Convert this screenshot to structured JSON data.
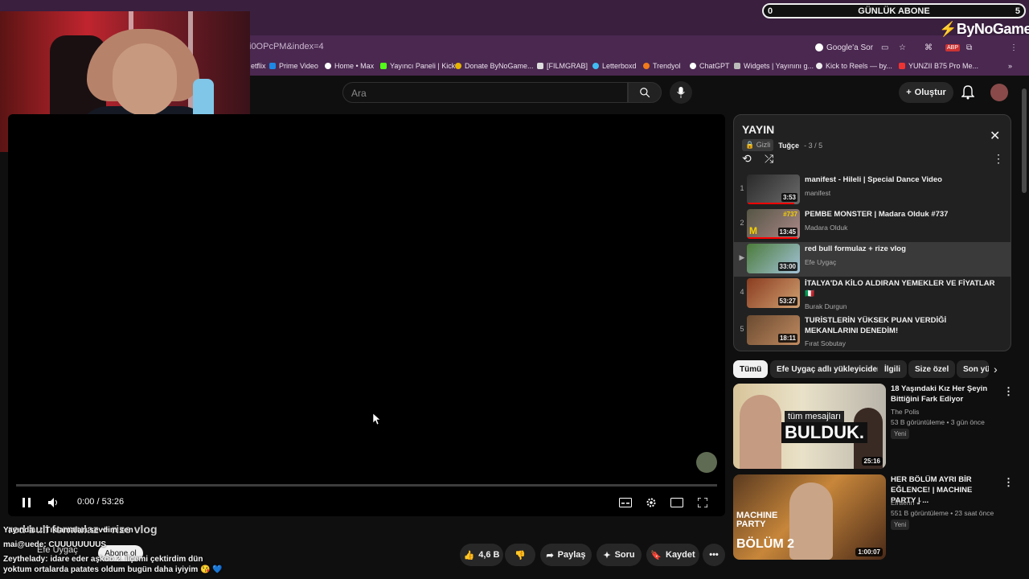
{
  "browser": {
    "url_fragment": "i0OPcPM&index=4",
    "google_chip": "Google'a Sor",
    "bookmarks": [
      "etflix",
      "Prime Video",
      "Home • Max",
      "Yayıncı Paneli | Kick",
      "Donate ByNoGame...",
      "[FILMGRAB]",
      "Letterboxd",
      "Trendyol",
      "ChatGPT",
      "Widgets | Yayınını g...",
      "Kick to Reels — by...",
      "YUNZII B75 Pro Me..."
    ]
  },
  "overlay": {
    "subs_label": "GÜNLÜK ABONE",
    "subs_left": "0",
    "subs_right": "5",
    "brand": "ByNoGame"
  },
  "header": {
    "search_placeholder": "Ara",
    "create_label": "Oluştur"
  },
  "player": {
    "time": "0:00 / 53:26",
    "progress": 0.0
  },
  "actions": {
    "likes": "4,6 B",
    "share": "Paylaş",
    "ask": "Soru",
    "save": "Kaydet"
  },
  "video": {
    "title": "red bull formulaz + rize vlog",
    "channel": "Efe Uygaç",
    "subscribe": "Abone ol"
  },
  "chat": [
    "Yayında...: Tıklamaları sevdim sen",
    "mai@uede: CUUUUUUUUS",
    "Zeythelady: idare eder aşkoo 2. ilçemi çektirdim dün",
    "yoktum ortalarda patates oldum bugün daha iyiyim 😘 💙"
  ],
  "playlist": {
    "title": "YAYIN",
    "privacy": "Gizli",
    "owner": "Tuğçe",
    "position": "3 / 5",
    "items": [
      {
        "idx": "1",
        "title": "manifest - Hileli | Special Dance Video",
        "channel": "manifest",
        "duration": "3:53",
        "watched": 0.9
      },
      {
        "idx": "2",
        "title": "PEMBE MONSTER | Madara Olduk #737",
        "channel": "Madara Olduk",
        "duration": "13:45",
        "watched": 0.95
      },
      {
        "idx": "▶",
        "title": "red bull formulaz + rize vlog",
        "channel": "Efe Uygaç",
        "duration": "33:00",
        "watched": 0.0
      },
      {
        "idx": "4",
        "title": "İTALYA'DA KİLO ALDIRAN YEMEKLER VE FİYATLAR 🇮🇹",
        "channel": "Burak Durgun",
        "duration": "53:27",
        "watched": 0.0
      },
      {
        "idx": "5",
        "title": "TURİSTLERİN YÜKSEK PUAN VERDİĞİ MEKANLARINI DENEDİM!",
        "channel": "Fırat Sobutay",
        "duration": "18:11",
        "watched": 0.0
      }
    ]
  },
  "chips": [
    "Tümü",
    "Efe Uygaç adlı yükleyiciden",
    "İlgili",
    "Size özel",
    "Son yü"
  ],
  "recommendations": [
    {
      "title": "18 Yaşındaki Kız Her Şeyin Bittiğini Fark Ediyor",
      "channel": "The Polis",
      "stats": "53 B görüntüleme • 3 gün önce",
      "badge": "Yeni",
      "duration": "25:16",
      "thumb_text": "BULDUK.",
      "thumb_sub": "tüm mesajları"
    },
    {
      "title": "HER BÖLÜM AYRI BİR EĞLENCE! | MACHINE PARTY | ...",
      "channel": "Elraenn ✔",
      "stats": "551 B görüntüleme • 23 saat önce",
      "badge": "Yeni",
      "duration": "1:00:07",
      "thumb_text": "BÖLÜM 2",
      "thumb_sub": "MACHINE PARTY"
    }
  ],
  "colors": {
    "accent": "#ff0000",
    "bg": "#0f0f0f",
    "panel": "#212121"
  }
}
